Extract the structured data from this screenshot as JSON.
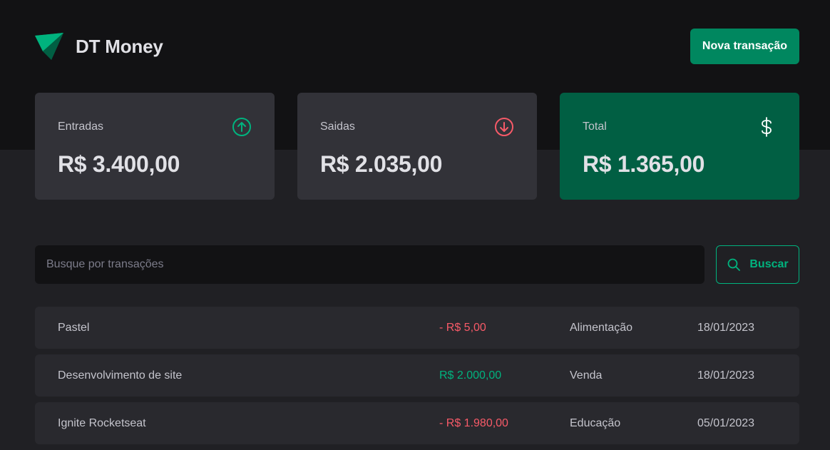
{
  "app": {
    "name": "DT Money"
  },
  "header": {
    "new_transaction_label": "Nova transação"
  },
  "summary": [
    {
      "label": "Entradas",
      "value": "R$ 3.400,00",
      "icon": "arrow-circle-up-icon"
    },
    {
      "label": "Saidas",
      "value": "R$ 2.035,00",
      "icon": "arrow-circle-down-icon"
    },
    {
      "label": "Total",
      "value": "R$ 1.365,00",
      "icon": "currency-dollar-icon"
    }
  ],
  "search": {
    "placeholder": "Busque por transações",
    "value": "",
    "button_label": "Buscar"
  },
  "transactions": [
    {
      "description": "Pastel",
      "price": "- R$ 5,00",
      "type": "outcome",
      "category": "Alimentação",
      "date": "18/01/2023"
    },
    {
      "description": "Desenvolvimento de site",
      "price": "R$ 2.000,00",
      "type": "income",
      "category": "Venda",
      "date": "18/01/2023"
    },
    {
      "description": "Ignite Rocketseat",
      "price": "- R$ 1.980,00",
      "type": "outcome",
      "category": "Educação",
      "date": "05/01/2023"
    }
  ],
  "colors": {
    "background": "#202024",
    "header_background": "#121214",
    "card": "#323238",
    "total_card": "#015f43",
    "primary_button": "#00875f",
    "income": "#00b37e",
    "outcome": "#f75a68"
  }
}
